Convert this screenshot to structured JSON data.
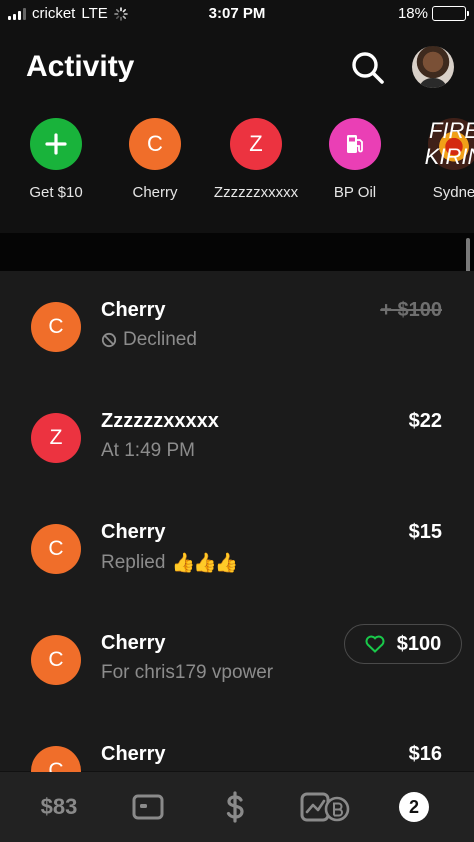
{
  "status_bar": {
    "carrier": "cricket",
    "network": "LTE",
    "time": "3:07 PM",
    "battery_percent": "18%",
    "battery_level": 0.18,
    "battery_color": "#f5c400"
  },
  "header": {
    "title": "Activity",
    "search_icon": "search-icon",
    "profile_icon": "profile-avatar"
  },
  "contacts": [
    {
      "initial": "+",
      "name": "Get $10",
      "color": "#19b33b"
    },
    {
      "initial": "C",
      "name": "Cherry",
      "color": "#f06e2a"
    },
    {
      "initial": "Z",
      "name": "Zzzzzzxxxxx",
      "color": "#ec3340"
    },
    {
      "initial": "",
      "name": "BP Oil",
      "color": "#ea3fb5",
      "icon": "gas-pump-icon"
    },
    {
      "initial": "FIRE KIRIN",
      "name": "Sydne",
      "icon": "fire-kirin-logo"
    }
  ],
  "activity": [
    {
      "initial": "C",
      "name": "Cherry",
      "detail": "Declined",
      "detail_icon": "declined-icon",
      "amount": "+ $100",
      "status": "declined",
      "color": "#f06e2a"
    },
    {
      "initial": "Z",
      "name": "Zzzzzzxxxxx",
      "detail": "At 1:49 PM",
      "amount": "$22",
      "color": "#ec3340"
    },
    {
      "initial": "C",
      "name": "Cherry",
      "detail": "Replied",
      "reaction": "👍👍👍",
      "amount": "$15",
      "color": "#f06e2a"
    },
    {
      "initial": "C",
      "name": "Cherry",
      "detail": "For chris179 vpower",
      "amount": "$100",
      "liked": true,
      "color": "#f06e2a"
    },
    {
      "initial": "C",
      "name": "Cherry",
      "detail": "",
      "amount": "$16",
      "color": "#f06e2a"
    }
  ],
  "bottom_nav": {
    "balance": "$83",
    "card_icon": "card-icon",
    "pay_icon": "dollar-icon",
    "investing_icon": "stocks-bitcoin-icon",
    "activity_badge": "2"
  },
  "colors": {
    "background": "#111111",
    "list_background": "#1b1b1b",
    "muted_text": "#8c8c8c",
    "heart_green": "#19c94a"
  }
}
